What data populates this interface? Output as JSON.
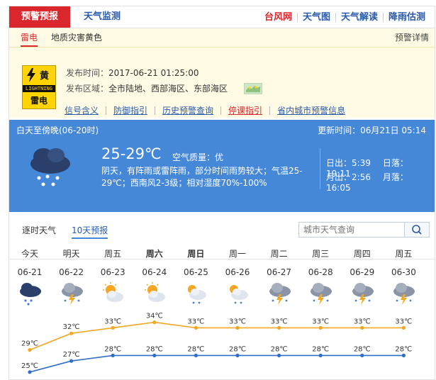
{
  "nav": {
    "active_tab": "预警预报",
    "monitor_tab": "天气监测",
    "links": [
      "台风网",
      "天气图",
      "天气解读",
      "降雨估测"
    ]
  },
  "warning": {
    "tabs": [
      "雷电",
      "地质灾害黄色"
    ],
    "detail_link": "预警详情",
    "badge": {
      "level": "黄",
      "eng": "LIGHTNING",
      "cn": "雷电",
      "color": "#ffd400"
    },
    "publish_label": "发布时间：",
    "publish_time": "2017-06-21 01:25:00",
    "area_label": "发布区域：",
    "area": "全市陆地、西部海区、东部海区",
    "links": [
      "信号含义",
      "防御指引",
      "历史预警查询",
      "停课指引",
      "省内城市预警信息"
    ]
  },
  "current": {
    "period": "白天至傍晚(06-20时)",
    "update": "更新时间：06月21日 05:14",
    "temp": "25-29℃",
    "aqi_label": "空气质量：",
    "aqi": "优",
    "desc": "阴天，有阵雨或雷阵雨，部分时间雨势较大；气温25-29℃；西南风2-3级；相对湿度70%-100%",
    "sunrise_label": "日出：",
    "sunrise": "5:39",
    "sunset_label": "日落：",
    "sunset": "19:11",
    "moonrise_label": "月出：",
    "moonrise": "2:56",
    "moonset_label": "月落：",
    "moonset": "16:05"
  },
  "forecast_tabs": [
    "逐时天气",
    "10天预报"
  ],
  "search": {
    "placeholder": "城市天气查询"
  },
  "forecast": {
    "days": [
      {
        "name": "今天",
        "date": "06-21",
        "icon": "heavy-rain-cloud-icon"
      },
      {
        "name": "明天",
        "date": "06-22",
        "icon": "thunder-rain-cloud-icon"
      },
      {
        "name": "周五",
        "date": "06-23",
        "icon": "sun-cloud-icon"
      },
      {
        "name": "周六",
        "date": "06-24",
        "icon": "sun-cloud-icon"
      },
      {
        "name": "周日",
        "date": "06-25",
        "icon": "sun-cloud-rain-icon"
      },
      {
        "name": "周一",
        "date": "06-26",
        "icon": "sun-cloud-rain-icon"
      },
      {
        "name": "周二",
        "date": "06-27",
        "icon": "thunder-rain-cloud-icon"
      },
      {
        "name": "周三",
        "date": "06-28",
        "icon": "thunder-rain-cloud-icon"
      },
      {
        "name": "周四",
        "date": "06-29",
        "icon": "thunder-rain-cloud-icon"
      },
      {
        "name": "周五",
        "date": "06-30",
        "icon": "thunder-rain-cloud-icon"
      }
    ],
    "bold_days": [
      3,
      4
    ],
    "high_label": [
      "29℃",
      "32℃",
      "33℃",
      "34℃",
      "33℃",
      "33℃",
      "33℃",
      "33℃",
      "33℃",
      "33℃"
    ],
    "low_label": [
      "25℃",
      "27℃",
      "28℃",
      "28℃",
      "28℃",
      "28℃",
      "28℃",
      "28℃",
      "28℃",
      "28℃"
    ],
    "highs": [
      29,
      32,
      33,
      34,
      33,
      33,
      33,
      33,
      33,
      33
    ],
    "lows": [
      25,
      27,
      28,
      28,
      28,
      28,
      28,
      28,
      28,
      28
    ],
    "colors": {
      "high": "#f5a623",
      "low": "#2f6fc5"
    }
  }
}
